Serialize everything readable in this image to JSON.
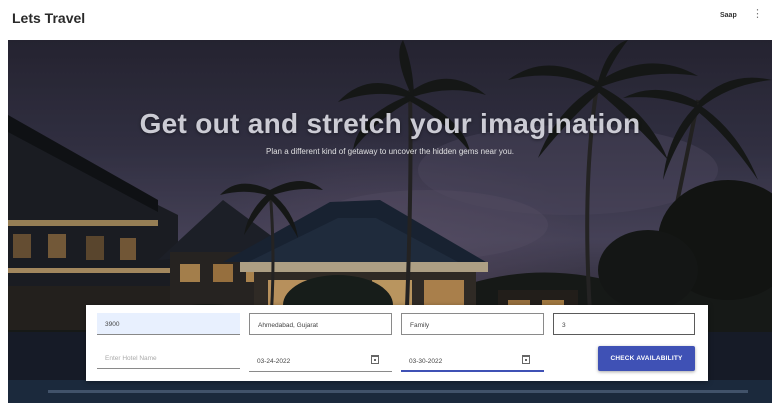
{
  "header": {
    "brand": "Lets Travel",
    "user_name": "Saap",
    "menu_glyph": "⋮",
    "menu_icon": "kebab-menu-icon"
  },
  "hero": {
    "headline": "Get out and stretch your imagination",
    "subline": "Plan a different kind of getaway to uncover the hidden gems near you."
  },
  "search": {
    "pincode": "3900",
    "city": "Ahmedabad, Gujarat",
    "room_type": "Family",
    "guests": "3",
    "hotel_name_placeholder": "Enter Hotel Name",
    "hotel_name": "",
    "checkin_date": "03-24-2022",
    "checkout_date": "03-30-2022",
    "calendar_icon": "calendar-icon",
    "submit_label": "CHECK AVAILABILITY"
  },
  "colors": {
    "primary": "#3f51b5",
    "autofill": "#e8f0fe",
    "brand_text": "#2a2a2a"
  }
}
